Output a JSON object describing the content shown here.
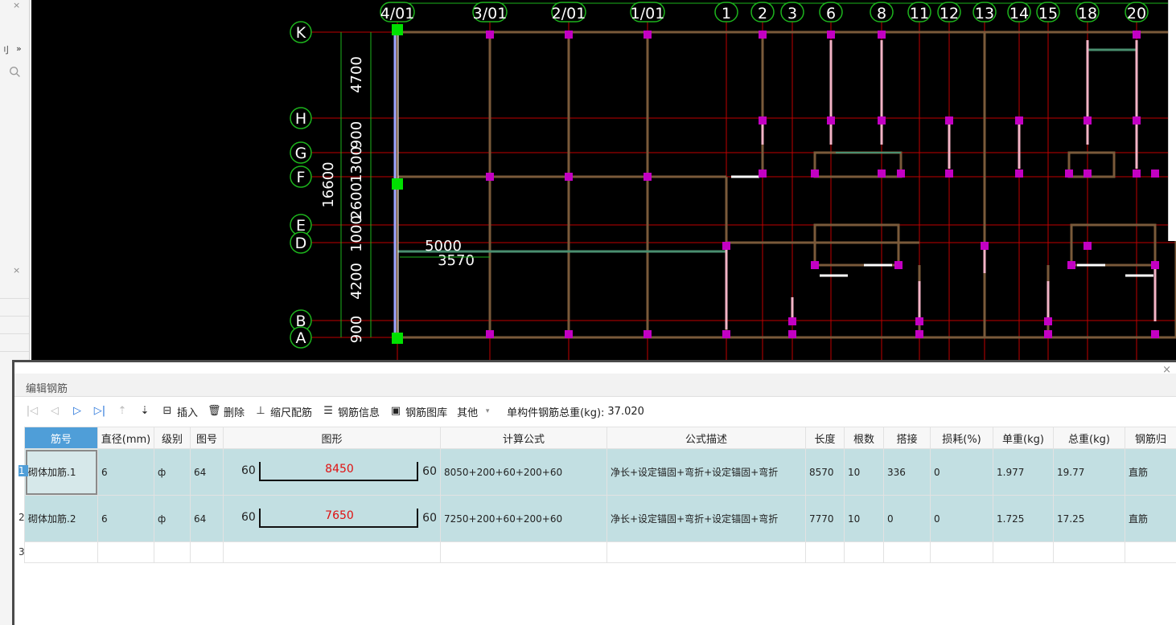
{
  "left_panel": {
    "tab_text": "刂",
    "arrow": "»"
  },
  "cad": {
    "top_axes": [
      "4/01",
      "3/01",
      "2/01",
      "1/01",
      "1",
      "2",
      "3",
      "6",
      "8",
      "11",
      "12",
      "13",
      "14",
      "15",
      "18",
      "20"
    ],
    "left_axes": [
      "K",
      "H",
      "G",
      "F",
      "E",
      "D",
      "B",
      "A"
    ],
    "vertical_dims": [
      "4700",
      "900",
      "1300",
      "2600",
      "1000",
      "4200",
      "900"
    ],
    "overall_dim": "16600",
    "beam_dims": [
      "5000",
      "3570"
    ]
  },
  "editor": {
    "title": "编辑钢筋",
    "toolbar": {
      "insert": "插入",
      "delete": "删除",
      "scale": "缩尺配筋",
      "info": "钢筋信息",
      "library": "钢筋图库",
      "other": "其他",
      "total_label": "单构件钢筋总重(kg):",
      "total_value": "37.020"
    },
    "columns": [
      "筋号",
      "直径(mm)",
      "级别",
      "图号",
      "图形",
      "计算公式",
      "公式描述",
      "长度",
      "根数",
      "搭接",
      "损耗(%)",
      "单重(kg)",
      "总重(kg)",
      "钢筋归"
    ],
    "rows": [
      {
        "no": "1",
        "name": "砌体加筋.1",
        "dia": "6",
        "grade": "ф",
        "fig": "64",
        "left": "60",
        "mid": "8450",
        "right": "60",
        "formula": "8050+200+60+200+60",
        "desc": "净长+设定锚固+弯折+设定锚固+弯折",
        "len": "8570",
        "count": "10",
        "lap": "336",
        "loss": "0",
        "unit": "1.977",
        "total": "19.77",
        "type": "直筋"
      },
      {
        "no": "2",
        "name": "砌体加筋.2",
        "dia": "6",
        "grade": "ф",
        "fig": "64",
        "left": "60",
        "mid": "7650",
        "right": "60",
        "formula": "7250+200+60+200+60",
        "desc": "净长+设定锚固+弯折+设定锚固+弯折",
        "len": "7770",
        "count": "10",
        "lap": "0",
        "loss": "0",
        "unit": "1.725",
        "total": "17.25",
        "type": "直筋"
      }
    ],
    "empty_row_no": "3"
  }
}
